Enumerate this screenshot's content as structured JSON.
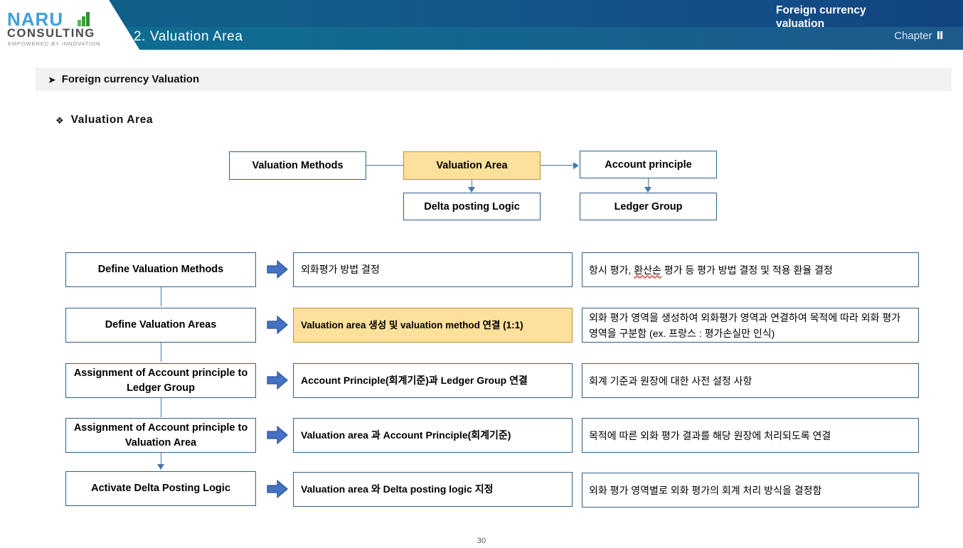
{
  "header": {
    "logo": {
      "name": "NARU",
      "sub": "CONSULTING",
      "tagline": "EMPOWERED BY INNOVATION"
    },
    "title": "2. Valuation Area",
    "right_title": "Foreign currency valuation",
    "chapter_label": "Chapter",
    "chapter_number": "Ⅱ",
    "colors": {
      "band_top": "#125f8b",
      "band_bottom": "#116a91",
      "title_text": "#ffffff"
    }
  },
  "section": {
    "bullet_icon": "arrow-bullet-icon",
    "title": "Foreign currency Valuation",
    "bar_color": "#f2f2f2"
  },
  "subsection": {
    "bullet_icon": "diamond-bullet-icon",
    "title": "Valuation Area"
  },
  "top_diagram": {
    "boxes": [
      {
        "id": "valuation-methods",
        "label": "Valuation Methods",
        "highlight": false
      },
      {
        "id": "valuation-area",
        "label": "Valuation Area",
        "highlight": true
      },
      {
        "id": "account-principle",
        "label": "Account principle",
        "highlight": false
      },
      {
        "id": "delta-posting-logic",
        "label": "Delta posting Logic",
        "highlight": false
      },
      {
        "id": "ledger-group",
        "label": "Ledger Group",
        "highlight": false
      }
    ],
    "connector_color": "#4878a8",
    "highlight_color": "#fce09b"
  },
  "flow_rows": [
    {
      "step": "Define Valuation Methods",
      "action": "외화평가 방법 결정",
      "action_bold": false,
      "action_highlight": false,
      "description_pre": "항시 평가, ",
      "description_spell": "환산손",
      "description_post": " 평가 등 평가 방법 결정 및 적용 환율 결정",
      "description": "항시 평가, 환산손 평가 등 평가 방법 결정 및 적용 환율 결정",
      "arrow_icon": "block-arrow-right-icon"
    },
    {
      "step": "Define Valuation Areas",
      "action": "Valuation area 생성 및 valuation method 연결 (1:1)",
      "action_bold": true,
      "action_highlight": true,
      "description": "외화 평가 영역을 생성하여 외화평가 영역과 연결하여 목적에 따라 외화 평가 영역을 구분함  (ex. 프랑스 : 평가손실만 인식)",
      "arrow_icon": "block-arrow-right-icon"
    },
    {
      "step": "Assignment of Account principle to Ledger Group",
      "action": "Account Principle(회계기준)과 Ledger Group 연결",
      "action_bold": true,
      "action_highlight": false,
      "description": "회계 기준과 원장에 대한 사전 설정 사항",
      "arrow_icon": "block-arrow-right-icon"
    },
    {
      "step": "Assignment of Account principle to Valuation Area",
      "action": "Valuation area 과 Account Principle(회계기준)",
      "action_bold": true,
      "action_highlight": false,
      "description": "목적에 따른 외화 평가 결과를 해당 원장에 처리되도록 연결",
      "arrow_icon": "block-arrow-right-icon"
    },
    {
      "step": "Activate Delta Posting Logic",
      "action": "Valuation area 와 Delta posting logic 지정",
      "action_bold": true,
      "action_highlight": false,
      "description": "외화 평가 영역별로 외화 평가의 회계 처리 방식을 결정함",
      "arrow_icon": "block-arrow-right-icon"
    }
  ],
  "page_number": "30"
}
